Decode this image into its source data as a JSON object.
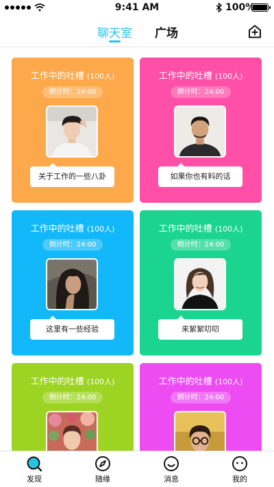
{
  "status_bar": {
    "time": "9:41 AM",
    "battery_percent_text": "100%",
    "battery_level": 1.0
  },
  "nav": {
    "tabs": [
      {
        "label": "聊天室",
        "active": true
      },
      {
        "label": "广场",
        "active": false
      }
    ],
    "add_icon": "home-add-icon",
    "accent_color": "#29c3e3"
  },
  "rooms": [
    {
      "title": "工作中的吐槽",
      "count": "(100人)",
      "timer": "倒计时：24:00",
      "topic": "关于工作的一些八卦",
      "color": "#fda84b"
    },
    {
      "title": "工作中的吐槽",
      "count": "(100人)",
      "timer": "倒计时：24:00",
      "topic": "如果你也有料的话",
      "color": "#ff4fa6"
    },
    {
      "title": "工作中的吐槽",
      "count": "(100人)",
      "timer": "倒计时：24:00",
      "topic": "这里有一些经验",
      "color": "#12b8fa"
    },
    {
      "title": "工作中的吐槽",
      "count": "(100人)",
      "timer": "倒计时：24:00",
      "topic": "来絮絮叨叨",
      "color": "#1bd48f"
    },
    {
      "title": "工作中的吐槽",
      "count": "(100人)",
      "timer": "倒计时：24:00",
      "color": "#9dd322"
    },
    {
      "title": "工作中的吐槽",
      "count": "(100人)",
      "timer": "倒计时：24:00",
      "color": "#ee4cf3"
    }
  ],
  "tab_bar": {
    "items": [
      {
        "label": "发现",
        "icon": "discover-icon"
      },
      {
        "label": "随缘",
        "icon": "compass-icon"
      },
      {
        "label": "消息",
        "icon": "message-face-icon"
      },
      {
        "label": "我的",
        "icon": "profile-face-icon"
      }
    ]
  }
}
